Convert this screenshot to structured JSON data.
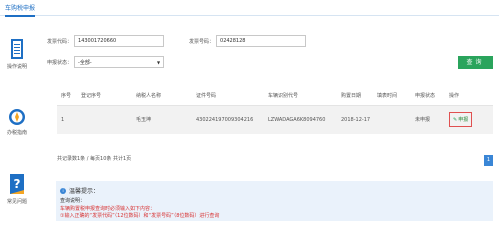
{
  "topbar": {
    "tab_label": "车购税申报"
  },
  "sidebar": {
    "items": [
      {
        "label": "操作说明",
        "icon": "document-icon"
      },
      {
        "label": "办税指南",
        "icon": "compass-icon"
      },
      {
        "label": "常见问题",
        "icon": "question-icon"
      }
    ]
  },
  "form": {
    "vin_label": "发票代码：",
    "vin_value": "143001720660",
    "invoice_no_label": "发票号码：",
    "invoice_no_value": "02428128",
    "status_label": "申报状态：",
    "status_value": "-全部-",
    "search_label": "查询"
  },
  "table": {
    "headers": [
      "序号",
      "登记序号",
      "纳税人名称",
      "证件号码",
      "车辆识别代号",
      "购置日期",
      "填表时间",
      "申报状态",
      "操作"
    ],
    "rows": [
      [
        "1",
        "",
        "毛玉坤",
        "43022419700930421​6",
        "LZWADAGA6K8094760",
        "2018-12-17",
        "",
        "未申报",
        "申报"
      ]
    ]
  },
  "pager": {
    "text": "共记录数1条 / 每页10条 共计1页",
    "current_page": "1"
  },
  "tips": {
    "title": "温馨提示：",
    "subtitle": "查询说明：",
    "lines": [
      "车辆购置税申报查询时必须输入如下内容：",
      "①输入正确的“发票代码”（12位数码）和“发票号码”（8位数码）进行查询"
    ]
  }
}
